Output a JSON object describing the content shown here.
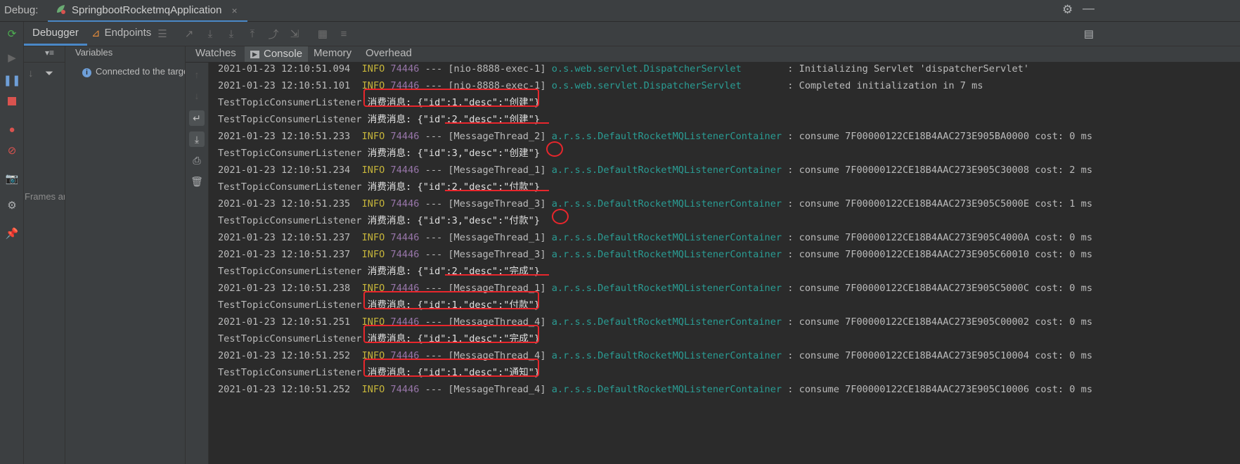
{
  "top": {
    "debug_label": "Debug:",
    "run_config": "SpringbootRocketmqApplication",
    "close_glyph": "×"
  },
  "debugger": {
    "tab_debugger": "Debugger",
    "tab_endpoints": "Endpoints"
  },
  "frames": {
    "empty_text": "Frames are not available"
  },
  "variables": {
    "title": "Variables",
    "message": "Connected to the target VM"
  },
  "console_tabs": [
    "Watches",
    "Console",
    "Memory",
    "Overhead"
  ],
  "console_lines": [
    {
      "kind": "log",
      "ts": "2021-01-23 12:10:51.094",
      "level": "INFO",
      "pid": "74446",
      "thread": "[nio-8888-exec-1]",
      "logger": "o.s.web.servlet.DispatcherServlet",
      "msg": "Initializing Servlet 'dispatcherServlet'"
    },
    {
      "kind": "log",
      "ts": "2021-01-23 12:10:51.101",
      "level": "INFO",
      "pid": "74446",
      "thread": "[nio-8888-exec-1]",
      "logger": "o.s.web.servlet.DispatcherServlet",
      "msg": "Completed initialization in 7 ms"
    },
    {
      "kind": "consume",
      "listener": "TestTopicConsumerListener",
      "text": "消费消息: {\"id\":1,\"desc\":\"创建\"}"
    },
    {
      "kind": "consume",
      "listener": "TestTopicConsumerListener",
      "text": "消费消息: {\"id\":2,\"desc\":\"创建\"}"
    },
    {
      "kind": "log",
      "ts": "2021-01-23 12:10:51.233",
      "level": "INFO",
      "pid": "74446",
      "thread": "[MessageThread_2]",
      "logger": "a.r.s.s.DefaultRocketMQListenerContainer",
      "msg": "consume 7F00000122CE18B4AAC273E905BA0000 cost: 0 ms"
    },
    {
      "kind": "consume",
      "listener": "TestTopicConsumerListener",
      "text": "消费消息: {\"id\":3,\"desc\":\"创建\"}"
    },
    {
      "kind": "log",
      "ts": "2021-01-23 12:10:51.234",
      "level": "INFO",
      "pid": "74446",
      "thread": "[MessageThread_1]",
      "logger": "a.r.s.s.DefaultRocketMQListenerContainer",
      "msg": "consume 7F00000122CE18B4AAC273E905C30008 cost: 2 ms"
    },
    {
      "kind": "consume",
      "listener": "TestTopicConsumerListener",
      "text": "消费消息: {\"id\":2,\"desc\":\"付款\"}"
    },
    {
      "kind": "log",
      "ts": "2021-01-23 12:10:51.235",
      "level": "INFO",
      "pid": "74446",
      "thread": "[MessageThread_3]",
      "logger": "a.r.s.s.DefaultRocketMQListenerContainer",
      "msg": "consume 7F00000122CE18B4AAC273E905C5000E cost: 1 ms"
    },
    {
      "kind": "consume",
      "listener": "TestTopicConsumerListener",
      "text": "消费消息: {\"id\":3,\"desc\":\"付款\"}"
    },
    {
      "kind": "log",
      "ts": "2021-01-23 12:10:51.237",
      "level": "INFO",
      "pid": "74446",
      "thread": "[MessageThread_1]",
      "logger": "a.r.s.s.DefaultRocketMQListenerContainer",
      "msg": "consume 7F00000122CE18B4AAC273E905C4000A cost: 0 ms"
    },
    {
      "kind": "log",
      "ts": "2021-01-23 12:10:51.237",
      "level": "INFO",
      "pid": "74446",
      "thread": "[MessageThread_3]",
      "logger": "a.r.s.s.DefaultRocketMQListenerContainer",
      "msg": "consume 7F00000122CE18B4AAC273E905C60010 cost: 0 ms"
    },
    {
      "kind": "consume",
      "listener": "TestTopicConsumerListener",
      "text": "消费消息: {\"id\":2,\"desc\":\"完成\"}"
    },
    {
      "kind": "log",
      "ts": "2021-01-23 12:10:51.238",
      "level": "INFO",
      "pid": "74446",
      "thread": "[MessageThread_1]",
      "logger": "a.r.s.s.DefaultRocketMQListenerContainer",
      "msg": "consume 7F00000122CE18B4AAC273E905C5000C cost: 0 ms"
    },
    {
      "kind": "consume",
      "listener": "TestTopicConsumerListener",
      "text": "消费消息: {\"id\":1,\"desc\":\"付款\"}"
    },
    {
      "kind": "log",
      "ts": "2021-01-23 12:10:51.251",
      "level": "INFO",
      "pid": "74446",
      "thread": "[MessageThread_4]",
      "logger": "a.r.s.s.DefaultRocketMQListenerContainer",
      "msg": "consume 7F00000122CE18B4AAC273E905C00002 cost: 0 ms"
    },
    {
      "kind": "consume",
      "listener": "TestTopicConsumerListener",
      "text": "消费消息: {\"id\":1,\"desc\":\"完成\"}"
    },
    {
      "kind": "log",
      "ts": "2021-01-23 12:10:51.252",
      "level": "INFO",
      "pid": "74446",
      "thread": "[MessageThread_4]",
      "logger": "a.r.s.s.DefaultRocketMQListenerContainer",
      "msg": "consume 7F00000122CE18B4AAC273E905C10004 cost: 0 ms"
    },
    {
      "kind": "consume",
      "listener": "TestTopicConsumerListener",
      "text": "消费消息: {\"id\":1,\"desc\":\"通知\"}"
    },
    {
      "kind": "log",
      "ts": "2021-01-23 12:10:51.252",
      "level": "INFO",
      "pid": "74446",
      "thread": "[MessageThread_4]",
      "logger": "a.r.s.s.DefaultRocketMQListenerContainer",
      "msg": "consume 7F00000122CE18B4AAC273E905C10006 cost: 0 ms"
    }
  ],
  "annotations": {
    "boxed_lines": [
      2,
      14,
      16,
      18
    ],
    "underlined_lines": [
      3,
      7,
      12
    ],
    "circled_lines": [
      5,
      9
    ]
  },
  "colors": {
    "accent": "#4a88c7",
    "annotation_red": "#e8262c",
    "info": "#c6b53a",
    "pid": "#9876aa",
    "logger": "#2a9d94"
  },
  "icons": {
    "rerun": "rerun-icon",
    "resume": "resume-icon",
    "pause": "pause-icon",
    "stop": "stop-icon",
    "view_breakpoints": "view-breakpoints-icon",
    "mute_breakpoints": "mute-breakpoints-icon",
    "camera": "get-thread-dump-icon",
    "settings": "settings-icon",
    "pin": "pin-icon"
  }
}
